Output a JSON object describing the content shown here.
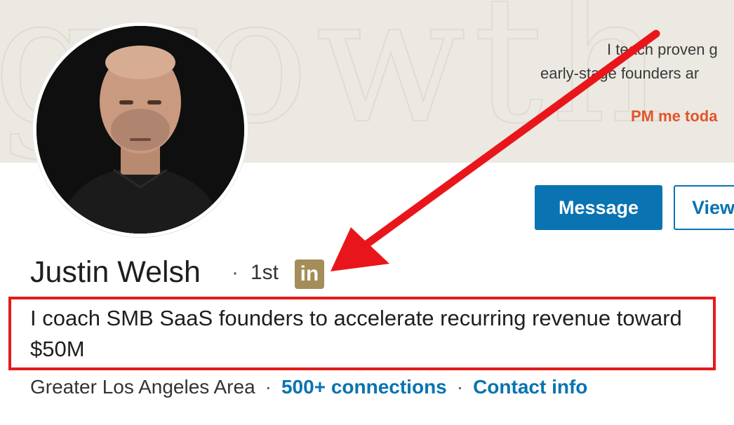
{
  "banner": {
    "line1": "I teach proven g",
    "line2": "early-stage founders ar",
    "cta": "PM me toda",
    "watermark": "growth"
  },
  "profile": {
    "name": "Justin Welsh",
    "separator": "·",
    "degree": "1st",
    "badge": "in",
    "headline": "I coach SMB SaaS founders to accelerate recurring revenue toward $50M",
    "location": "Greater Los Angeles Area",
    "connections": "500+ connections",
    "contact": "Contact info"
  },
  "actions": {
    "message": "Message",
    "view": "View"
  },
  "colors": {
    "accent": "#0a73b1",
    "annotation": "#e21b1b",
    "badge": "#a48d58",
    "banner_cta": "#e2552b"
  }
}
